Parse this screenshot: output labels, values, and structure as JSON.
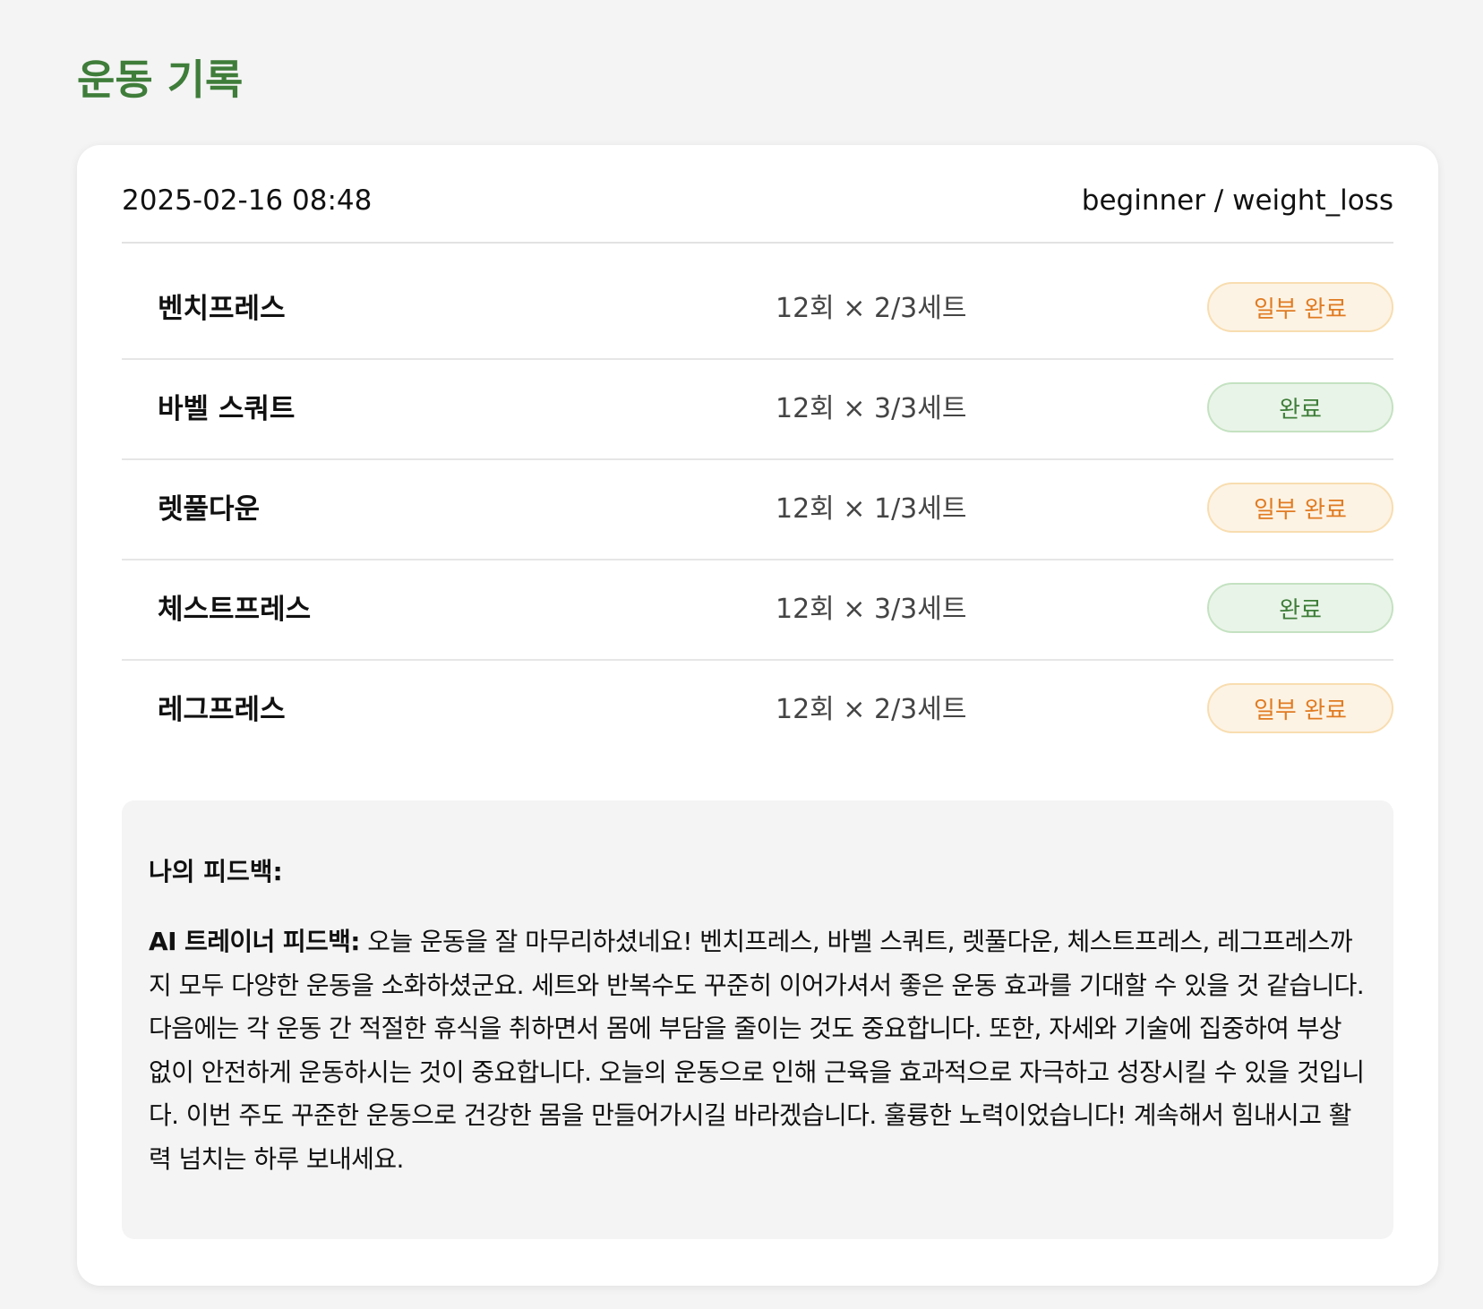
{
  "page": {
    "title": "운동 기록"
  },
  "record": {
    "datetime": "2025-02-16 08:48",
    "profile": "beginner / weight_loss"
  },
  "exercises": [
    {
      "name": "벤치프레스",
      "reps": "12회 × 2/3세트",
      "status": "일부 완료"
    },
    {
      "name": "바벨 스쿼트",
      "reps": "12회 × 3/3세트",
      "status": "완료"
    },
    {
      "name": "렛풀다운",
      "reps": "12회 × 1/3세트",
      "status": "일부 완료"
    },
    {
      "name": "체스트프레스",
      "reps": "12회 × 3/3세트",
      "status": "완료"
    },
    {
      "name": "레그프레스",
      "reps": "12회 × 2/3세트",
      "status": "일부 완료"
    }
  ],
  "feedback": {
    "my_label": "나의 피드백:",
    "ai_label": "AI 트레이너 피드백:",
    "ai_text": "오늘 운동을 잘 마무리하셨네요! 벤치프레스, 바벨 스쿼트, 렛풀다운, 체스트프레스, 레그프레스까지 모두 다양한 운동을 소화하셨군요. 세트와 반복수도 꾸준히 이어가셔서 좋은 운동 효과를 기대할 수 있을 것 같습니다. 다음에는 각 운동 간 적절한 휴식을 취하면서 몸에 부담을 줄이는 것도 중요합니다. 또한, 자세와 기술에 집중하여 부상 없이 안전하게 운동하시는 것이 중요합니다. 오늘의 운동으로 인해 근육을 효과적으로 자극하고 성장시킬 수 있을 것입니다. 이번 주도 꾸준한 운동으로 건강한 몸을 만들어가시길 바라겠습니다. 훌륭한 노력이었습니다! 계속해서 힘내시고 활력 넘치는 하루 보내세요."
  },
  "colors": {
    "title_green": "#3f7d3a",
    "partial_orange": "#e07b22",
    "done_green": "#3d7d37"
  }
}
